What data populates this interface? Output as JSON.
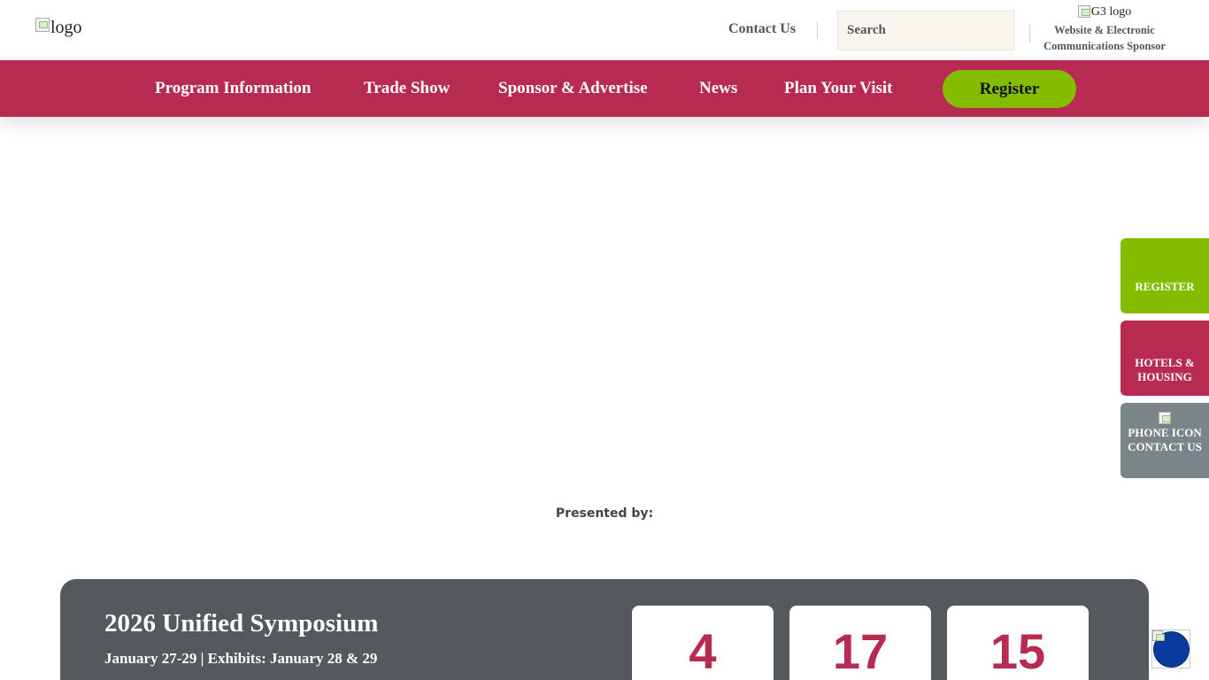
{
  "header": {
    "logo_alt": "logo",
    "contact_label": "Contact Us",
    "search_placeholder": "Search",
    "sponsor_logo_alt": "G3 logo",
    "sponsor_text": "Website & Electronic Communications Sponsor"
  },
  "nav": {
    "items": [
      {
        "label": "Program Information"
      },
      {
        "label": "Trade Show"
      },
      {
        "label": "Sponsor & Advertise"
      },
      {
        "label": "News"
      },
      {
        "label": "Plan Your Visit"
      }
    ],
    "register_label": "Register"
  },
  "side_tabs": {
    "register": "REGISTER",
    "hotels": "HOTELS & HOUSING",
    "phone_icon_alt": "PHONE ICON",
    "contact": "CONTACT US"
  },
  "presented_by": "Presented by:",
  "event": {
    "title": "2026 Unified Symposium",
    "dates": "January 27-29 | Exhibits: January 28 & 29",
    "countdown": [
      "4",
      "17",
      "15"
    ]
  },
  "colors": {
    "brand": "#b72a52",
    "accent": "#84bd00",
    "gray_tab": "#7b8489",
    "card": "#55585c"
  }
}
